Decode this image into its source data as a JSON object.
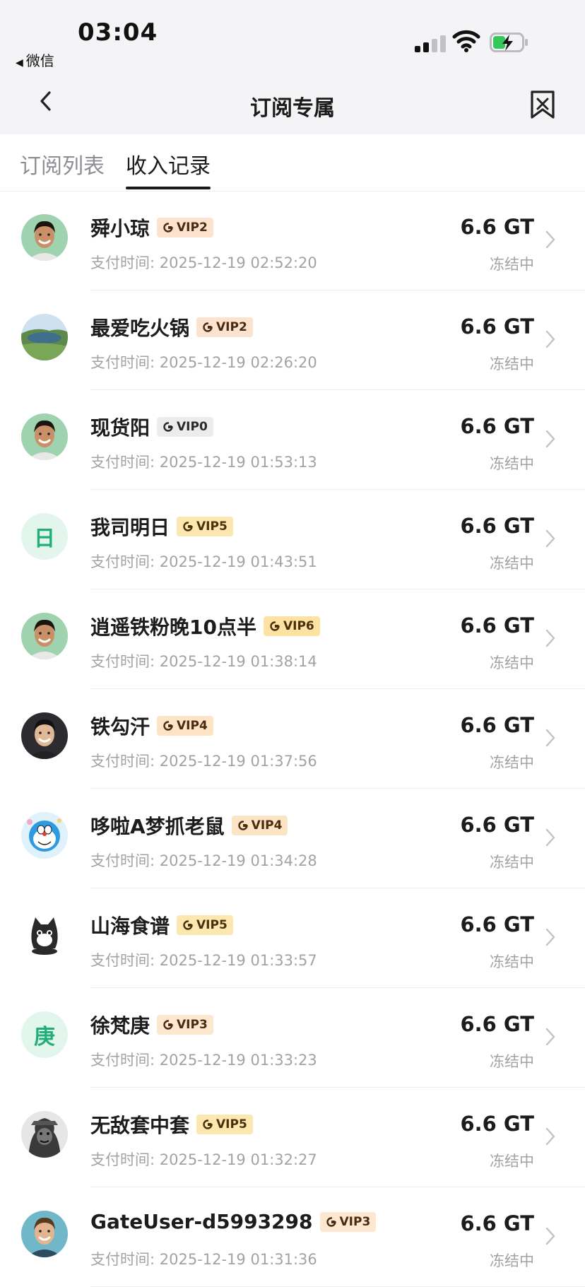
{
  "status_bar": {
    "time": "03:04",
    "back_app": "微信"
  },
  "nav": {
    "title": "订阅专属"
  },
  "tabs": [
    {
      "label": "订阅列表",
      "active": false
    },
    {
      "label": "收入记录",
      "active": true
    }
  ],
  "records": [
    {
      "name": "舜小琼",
      "vip": "VIP2",
      "paid_at": "支付时间: 2025-12-19 02:52:20",
      "amount": "6.6 GT",
      "status": "冻结中",
      "avatar": "photo-smiling-man"
    },
    {
      "name": "最爱吃火锅",
      "vip": "VIP2",
      "paid_at": "支付时间: 2025-12-19 02:26:20",
      "amount": "6.6 GT",
      "status": "冻结中",
      "avatar": "photo-lake-landscape"
    },
    {
      "name": "现货阳",
      "vip": "VIP0",
      "paid_at": "支付时间: 2025-12-19 01:53:13",
      "amount": "6.6 GT",
      "status": "冻结中",
      "avatar": "photo-smiling-man"
    },
    {
      "name": "我司明日",
      "vip": "VIP5",
      "paid_at": "支付时间: 2025-12-19 01:43:51",
      "amount": "6.6 GT",
      "status": "冻结中",
      "avatar_char": "日"
    },
    {
      "name": "逍遥铁粉晚10点半",
      "vip": "VIP6",
      "paid_at": "支付时间: 2025-12-19 01:38:14",
      "amount": "6.6 GT",
      "status": "冻结中",
      "avatar": "photo-smiling-man"
    },
    {
      "name": "铁勾汗",
      "vip": "VIP4",
      "paid_at": "支付时间: 2025-12-19 01:37:56",
      "amount": "6.6 GT",
      "status": "冻结中",
      "avatar": "photo-man-dark"
    },
    {
      "name": "哆啦A梦抓老鼠",
      "vip": "VIP4",
      "paid_at": "支付时间: 2025-12-19 01:34:28",
      "amount": "6.6 GT",
      "status": "冻结中",
      "avatar": "cartoon-doraemon"
    },
    {
      "name": "山海食谱",
      "vip": "VIP5",
      "paid_at": "支付时间: 2025-12-19 01:33:57",
      "amount": "6.6 GT",
      "status": "冻结中",
      "avatar": "cartoon-cat"
    },
    {
      "name": "徐梵庚",
      "vip": "VIP3",
      "paid_at": "支付时间: 2025-12-19 01:33:23",
      "amount": "6.6 GT",
      "status": "冻结中",
      "avatar_char": "庚"
    },
    {
      "name": "无敌套中套",
      "vip": "VIP5",
      "paid_at": "支付时间: 2025-12-19 01:32:27",
      "amount": "6.6 GT",
      "status": "冻结中",
      "avatar": "photo-gorilla"
    },
    {
      "name": "GateUser-d5993298",
      "vip": "VIP3",
      "paid_at": "支付时间: 2025-12-19 01:31:36",
      "amount": "6.6 GT",
      "status": "冻结中",
      "avatar": "photo-young-man"
    }
  ]
}
